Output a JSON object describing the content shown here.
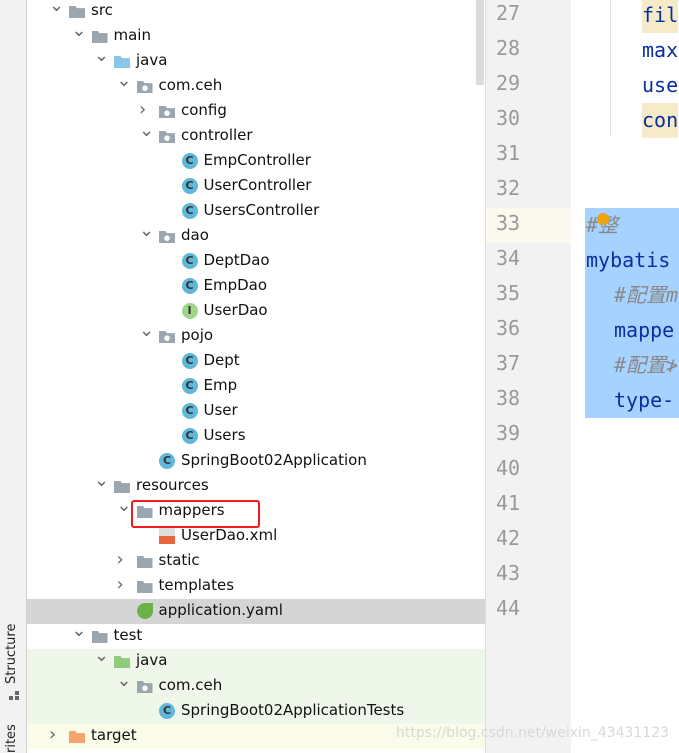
{
  "side_strip": {
    "structure": "Structure",
    "favorites": "rites"
  },
  "tree": [
    {
      "label": "src",
      "level": 0,
      "state": "open",
      "icon": "folder",
      "color": "#9aa7b0"
    },
    {
      "label": "main",
      "level": 1,
      "state": "open",
      "icon": "folder",
      "color": "#9aa7b0"
    },
    {
      "label": "java",
      "level": 2,
      "state": "open",
      "icon": "source-folder",
      "color": "#87c7e8"
    },
    {
      "label": "com.ceh",
      "level": 3,
      "state": "open",
      "icon": "package"
    },
    {
      "label": "config",
      "level": 4,
      "state": "closed",
      "icon": "package"
    },
    {
      "label": "controller",
      "level": 4,
      "state": "open",
      "icon": "package"
    },
    {
      "label": "EmpController",
      "level": 5,
      "icon": "class"
    },
    {
      "label": "UserController",
      "level": 5,
      "icon": "class"
    },
    {
      "label": "UsersController",
      "level": 5,
      "icon": "class"
    },
    {
      "label": "dao",
      "level": 4,
      "state": "open",
      "icon": "package"
    },
    {
      "label": "DeptDao",
      "level": 5,
      "icon": "class"
    },
    {
      "label": "EmpDao",
      "level": 5,
      "icon": "class"
    },
    {
      "label": "UserDao",
      "level": 5,
      "icon": "interface"
    },
    {
      "label": "pojo",
      "level": 4,
      "state": "open",
      "icon": "package"
    },
    {
      "label": "Dept",
      "level": 5,
      "icon": "class"
    },
    {
      "label": "Emp",
      "level": 5,
      "icon": "class"
    },
    {
      "label": "User",
      "level": 5,
      "icon": "class"
    },
    {
      "label": "Users",
      "level": 5,
      "icon": "class"
    },
    {
      "label": "SpringBoot02Application",
      "level": 4,
      "icon": "spring-class"
    },
    {
      "label": "resources",
      "level": 2,
      "state": "open",
      "icon": "resources-folder"
    },
    {
      "label": "mappers",
      "level": 3,
      "state": "open",
      "icon": "folder",
      "color": "#9aa7b0",
      "highlighted": true
    },
    {
      "label": "UserDao.xml",
      "level": 4,
      "icon": "xml-file"
    },
    {
      "label": "static",
      "level": 3,
      "state": "closed",
      "icon": "folder",
      "color": "#9aa7b0"
    },
    {
      "label": "templates",
      "level": 3,
      "state": "closed",
      "icon": "folder",
      "color": "#9aa7b0"
    },
    {
      "label": "application.yaml",
      "level": 3,
      "icon": "yaml-spring",
      "selected": true
    },
    {
      "label": "test",
      "level": 1,
      "state": "open",
      "icon": "folder",
      "color": "#9aa7b0"
    },
    {
      "label": "java",
      "level": 2,
      "state": "open",
      "icon": "test-folder",
      "color": "#8fcb7a",
      "bg": "#eff7ea"
    },
    {
      "label": "com.ceh",
      "level": 3,
      "state": "open",
      "icon": "package",
      "bg": "#eff7ea"
    },
    {
      "label": "SpringBoot02ApplicationTests",
      "level": 4,
      "icon": "spring-class",
      "bg": "#eff7ea"
    },
    {
      "label": "target",
      "level": 0,
      "state": "closed",
      "icon": "folder",
      "color": "#f5a46e",
      "bg": "#fbfbe9"
    }
  ],
  "editor": {
    "line_numbers": [
      "27",
      "28",
      "29",
      "30",
      "31",
      "32",
      "33",
      "34",
      "35",
      "36",
      "37",
      "38",
      "39",
      "40",
      "41",
      "42",
      "43",
      "44"
    ],
    "lines": [
      {
        "n": "27",
        "text": "fil",
        "indent": 2,
        "mark": true
      },
      {
        "n": "28",
        "text": "max",
        "indent": 2
      },
      {
        "n": "29",
        "text": "use",
        "indent": 2
      },
      {
        "n": "30",
        "text": "con",
        "indent": 2,
        "mark": true
      },
      {
        "n": "33",
        "text": "  #整",
        "indent": 0,
        "comment": true,
        "selected": true
      },
      {
        "n": "34",
        "text": "mybatis",
        "indent": 0,
        "selected": true
      },
      {
        "n": "35",
        "text": "#配置m",
        "indent": 1,
        "comment": true,
        "selected": true
      },
      {
        "n": "36",
        "text": "mappe",
        "indent": 1,
        "selected": true
      },
      {
        "n": "37",
        "text": "#配置≯",
        "indent": 1,
        "comment": true,
        "selected": true
      },
      {
        "n": "38",
        "text": "type-",
        "indent": 1,
        "selected": true
      }
    ]
  },
  "watermark": "https://blog.csdn.net/weixin_43431123"
}
